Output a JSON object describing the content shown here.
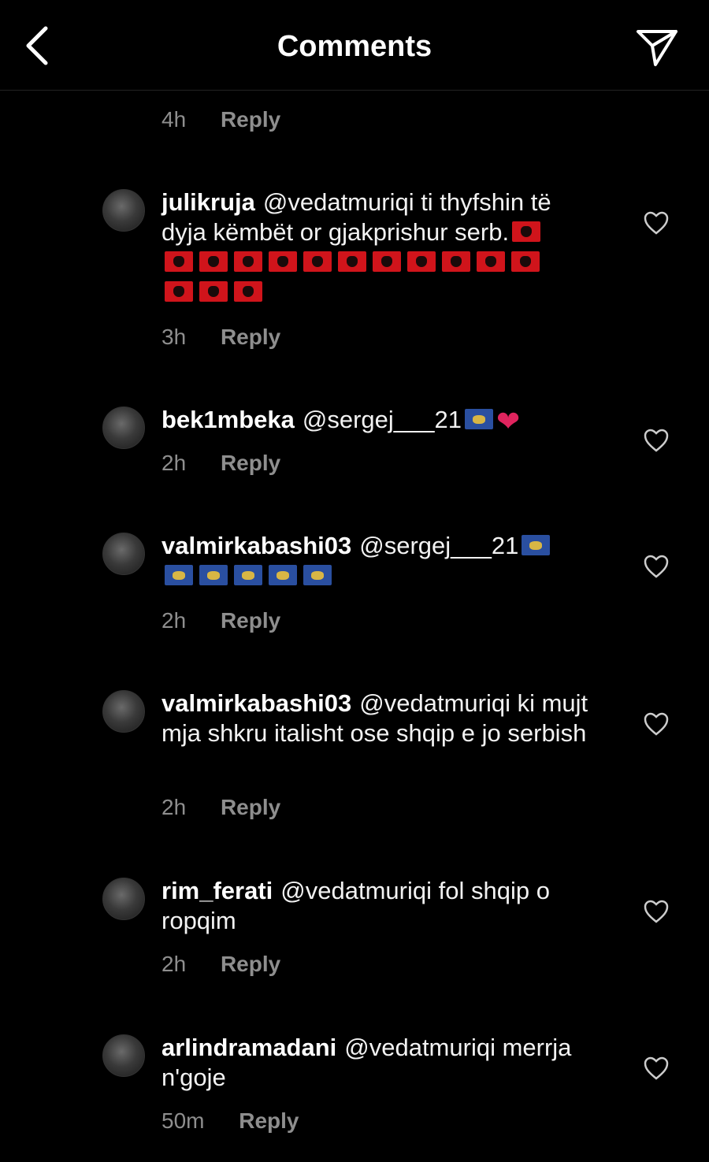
{
  "header": {
    "title": "Comments"
  },
  "icons": {
    "back": "chevron-left-icon",
    "send": "paper-plane-icon",
    "like": "heart-outline-icon"
  },
  "top_meta": {
    "time": "4h",
    "reply": "Reply"
  },
  "comments": [
    {
      "username": "julikruja",
      "text": "@vedatmuriqi ti thyfshin të dyja këmbët or gjakprishur serb.",
      "flags": {
        "type": "albania",
        "count": 15
      },
      "time": "3h",
      "reply": "Reply"
    },
    {
      "username": "bek1mbeka",
      "text": "@sergej___21",
      "flags": {
        "type": "kosovo",
        "count": 1
      },
      "time": "2h",
      "reply": "Reply"
    },
    {
      "username": "valmirkabashi03",
      "text": "@sergej___21",
      "flags": {
        "type": "kosovo",
        "count": 6
      },
      "time": "2h",
      "reply": "Reply"
    },
    {
      "username": "valmirkabashi03",
      "text": "@vedatmuriqi ki mujt mja shkru italisht ose shqip e jo serbish",
      "time": "2h",
      "reply": "Reply"
    },
    {
      "username": "rim_ferati",
      "text": "@vedatmuriqi fol shqip o ropqim",
      "time": "2h",
      "reply": "Reply"
    },
    {
      "username": "arlindramadani",
      "text": "@vedatmuriqi merrja n'goje",
      "time": "50m",
      "reply": "Reply"
    }
  ],
  "colors": {
    "background": "#000000",
    "text": "#f2f2f2",
    "muted": "#8e8e8e",
    "heart_red": "#e0245e"
  }
}
